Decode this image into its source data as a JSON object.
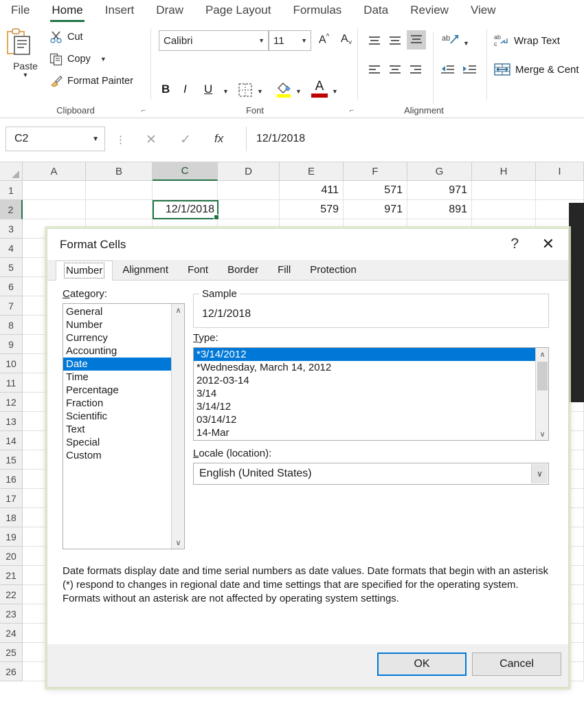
{
  "ribbon": {
    "tabs": [
      {
        "label": "File",
        "active": false
      },
      {
        "label": "Home",
        "active": true
      },
      {
        "label": "Insert",
        "active": false
      },
      {
        "label": "Draw",
        "active": false
      },
      {
        "label": "Page Layout",
        "active": false
      },
      {
        "label": "Formulas",
        "active": false
      },
      {
        "label": "Data",
        "active": false
      },
      {
        "label": "Review",
        "active": false
      },
      {
        "label": "View",
        "active": false
      }
    ],
    "active_tab_accent": "#217346",
    "groups": {
      "clipboard": {
        "label": "Clipboard",
        "paste_label": "Paste",
        "cut_label": "Cut",
        "copy_label": "Copy",
        "format_painter_label": "Format Painter"
      },
      "font": {
        "label": "Font",
        "font_name": "Calibri",
        "font_size": "11",
        "bold": "B",
        "italic": "I",
        "underline": "U",
        "grow_font": "A",
        "shrink_font": "A",
        "highlight_color": "#ffff00",
        "font_color": "#c00000"
      },
      "alignment": {
        "label": "Alignment",
        "wrap_text_label": "Wrap Text",
        "merge_center_label": "Merge & Cent"
      }
    }
  },
  "formula_bar": {
    "name_box_value": "C2",
    "cancel_icon": "✕",
    "enter_icon": "✓",
    "function_icon": "fx",
    "value": "12/1/2018"
  },
  "sheet": {
    "columns": [
      "A",
      "B",
      "C",
      "D",
      "E",
      "F",
      "G",
      "H",
      "I"
    ],
    "selected_column": "C",
    "rows": [
      "1",
      "2",
      "3",
      "4",
      "5",
      "6",
      "7",
      "8",
      "9",
      "10",
      "11",
      "12",
      "13",
      "14",
      "15",
      "16",
      "17",
      "18",
      "19",
      "20",
      "21",
      "22",
      "23",
      "24",
      "25",
      "26"
    ],
    "selected_row": "2",
    "active_cell": {
      "ref": "C2",
      "value": "12/1/2018"
    },
    "data": [
      {
        "row": "1",
        "cells": {
          "E": "411",
          "F": "571",
          "G": "971"
        }
      },
      {
        "row": "2",
        "cells": {
          "E": "579",
          "F": "971",
          "G": "891"
        }
      }
    ]
  },
  "dialog": {
    "title": "Format Cells",
    "help_icon": "?",
    "close_icon": "✕",
    "tabs": [
      {
        "label": "Number",
        "active": true
      },
      {
        "label": "Alignment",
        "active": false
      },
      {
        "label": "Font",
        "active": false
      },
      {
        "label": "Border",
        "active": false
      },
      {
        "label": "Fill",
        "active": false
      },
      {
        "label": "Protection",
        "active": false
      }
    ],
    "category": {
      "label": "Category:",
      "label_accel": "C",
      "label_rest": "ategory:",
      "items": [
        "General",
        "Number",
        "Currency",
        "Accounting",
        "Date",
        "Time",
        "Percentage",
        "Fraction",
        "Scientific",
        "Text",
        "Special",
        "Custom"
      ],
      "selected": "Date",
      "scroll_up_icon": "∧",
      "scroll_down_icon": "∨"
    },
    "sample": {
      "legend": "Sample",
      "value": "12/1/2018"
    },
    "type": {
      "label_accel": "T",
      "label_rest": "ype:",
      "items": [
        "*3/14/2012",
        "*Wednesday, March 14, 2012",
        "2012-03-14",
        "3/14",
        "3/14/12",
        "03/14/12",
        "14-Mar"
      ],
      "selected": "*3/14/2012",
      "scroll_up_icon": "∧",
      "scroll_down_icon": "∨"
    },
    "locale": {
      "label_accel": "L",
      "label_rest": "ocale (location):",
      "value": "English (United States)",
      "arrow_icon": "∨"
    },
    "description": "Date formats display date and time serial numbers as date values.  Date formats that begin with an asterisk (*) respond to changes in regional date and time settings that are specified for the operating system. Formats without an asterisk are not affected by operating system settings.",
    "ok_label": "OK",
    "cancel_label": "Cancel",
    "accent_color": "#0078d7",
    "selection_color": "#0078d7"
  }
}
